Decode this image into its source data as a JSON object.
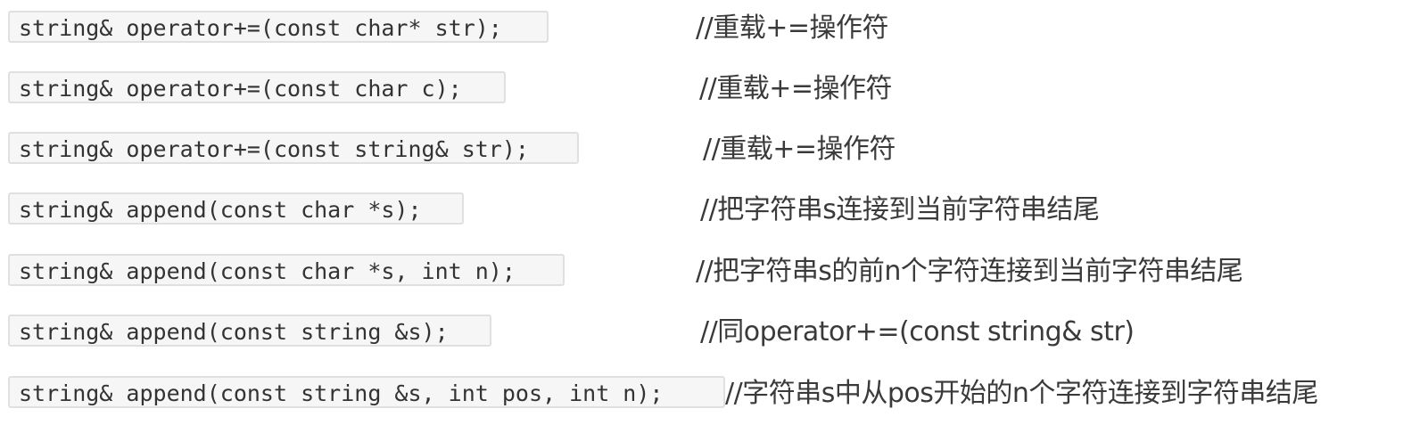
{
  "rows": [
    {
      "code": "string& operator+=(const char* str);",
      "comment": "//重载+=操作符"
    },
    {
      "code": "string& operator+=(const char c);",
      "comment": "//重载+=操作符"
    },
    {
      "code": "string& operator+=(const string& str);",
      "comment": "//重载+=操作符"
    },
    {
      "code": "string& append(const char *s);",
      "comment": "//把字符串s连接到当前字符串结尾"
    },
    {
      "code": "string& append(const char *s, int n);",
      "comment": "//把字符串s的前n个字符连接到当前字符串结尾"
    },
    {
      "code": "string& append(const string &s);",
      "comment": "//同operator+=(const string& str)"
    },
    {
      "code": "string& append(const string &s, int pos, int n);",
      "comment": "//字符串s中从pos开始的n个字符连接到字符串结尾"
    }
  ]
}
